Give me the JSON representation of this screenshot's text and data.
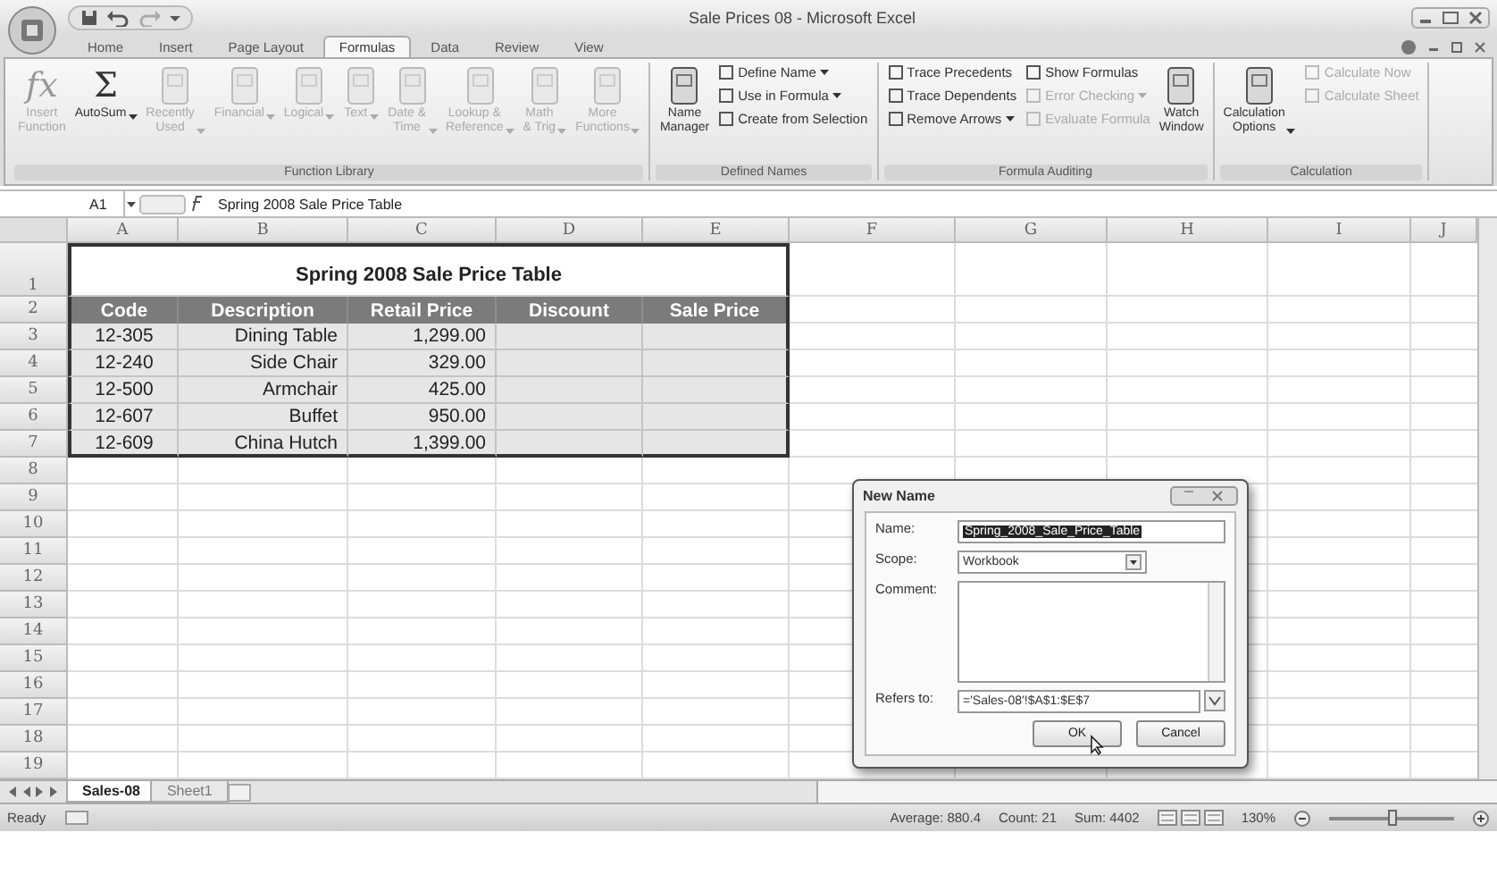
{
  "title_bar": {
    "title": "Sale Prices 08 - Microsoft Excel"
  },
  "ribbon": {
    "tabs": [
      {
        "label": "Home",
        "selected": false
      },
      {
        "label": "Insert",
        "selected": false
      },
      {
        "label": "Page Layout",
        "selected": false
      },
      {
        "label": "Formulas",
        "selected": true
      },
      {
        "label": "Data",
        "selected": false
      },
      {
        "label": "Review",
        "selected": false
      },
      {
        "label": "View",
        "selected": false
      }
    ],
    "groups": [
      {
        "label": "Function Library",
        "items": [
          {
            "kind": "large",
            "glyph": "fx",
            "label": "Insert\nFunction",
            "disabled": true,
            "dropdown": false
          },
          {
            "kind": "large",
            "glyph": "Σ",
            "label": "AutoSum",
            "disabled": false,
            "dropdown": true
          },
          {
            "kind": "large",
            "label": "Recently\nUsed",
            "disabled": true,
            "dropdown": true
          },
          {
            "kind": "large",
            "label": "Financial",
            "disabled": true,
            "dropdown": true
          },
          {
            "kind": "large",
            "label": "Logical",
            "disabled": true,
            "dropdown": true
          },
          {
            "kind": "large",
            "label": "Text",
            "disabled": true,
            "dropdown": true
          },
          {
            "kind": "large",
            "label": "Date &\nTime",
            "disabled": true,
            "dropdown": true
          },
          {
            "kind": "large",
            "label": "Lookup &\nReference",
            "disabled": true,
            "dropdown": true
          },
          {
            "kind": "large",
            "label": "Math\n& Trig",
            "disabled": true,
            "dropdown": true
          },
          {
            "kind": "large",
            "label": "More\nFunctions",
            "disabled": true,
            "dropdown": true
          }
        ]
      },
      {
        "label": "Defined Names",
        "items": [
          {
            "kind": "large",
            "label": "Name\nManager",
            "disabled": false,
            "dropdown": false
          },
          {
            "kind": "small",
            "label": "Define Name",
            "disabled": false,
            "dropdown": true
          },
          {
            "kind": "small",
            "label": "Use in Formula",
            "disabled": false,
            "dropdown": true
          },
          {
            "kind": "small",
            "label": "Create from Selection",
            "disabled": false,
            "dropdown": false
          }
        ]
      },
      {
        "label": "Formula Auditing",
        "items": [
          {
            "kind": "small",
            "label": "Trace Precedents",
            "disabled": false,
            "dropdown": false
          },
          {
            "kind": "small",
            "label": "Trace Dependents",
            "disabled": false,
            "dropdown": false
          },
          {
            "kind": "small",
            "label": "Remove Arrows",
            "disabled": false,
            "dropdown": true
          },
          {
            "kind": "small",
            "label": "Show Formulas",
            "disabled": false,
            "dropdown": false
          },
          {
            "kind": "small",
            "label": "Error Checking",
            "disabled": true,
            "dropdown": true
          },
          {
            "kind": "small",
            "label": "Evaluate Formula",
            "disabled": true,
            "dropdown": false
          },
          {
            "kind": "large",
            "label": "Watch\nWindow",
            "disabled": false,
            "dropdown": false
          }
        ]
      },
      {
        "label": "Calculation",
        "items": [
          {
            "kind": "large",
            "label": "Calculation\nOptions",
            "disabled": false,
            "dropdown": true
          },
          {
            "kind": "small",
            "label": "Calculate Now",
            "disabled": true,
            "dropdown": false
          },
          {
            "kind": "small",
            "label": "Calculate Sheet",
            "disabled": true,
            "dropdown": false
          }
        ]
      }
    ]
  },
  "formula_bar": {
    "name_box": "A1",
    "formula": "Spring 2008 Sale Price Table"
  },
  "sheet": {
    "columns": [
      "A",
      "B",
      "C",
      "D",
      "E",
      "F",
      "G",
      "H",
      "I",
      "J"
    ],
    "rows": [
      "1",
      "2",
      "3",
      "4",
      "5",
      "6",
      "7",
      "8",
      "9",
      "10",
      "11",
      "12",
      "13",
      "14",
      "15",
      "16",
      "17",
      "18",
      "19"
    ],
    "table": {
      "title": "Spring 2008 Sale Price Table",
      "headers": [
        "Code",
        "Description",
        "Retail Price",
        "Discount",
        "Sale Price"
      ],
      "rows": [
        [
          "12-305",
          "Dining Table",
          "1,299.00"
        ],
        [
          "12-240",
          "Side Chair",
          "329.00"
        ],
        [
          "12-500",
          "Armchair",
          "425.00"
        ],
        [
          "12-607",
          "Buffet",
          "950.00"
        ],
        [
          "12-609",
          "China Hutch",
          "1,399.00"
        ]
      ]
    }
  },
  "dialog": {
    "title": "New Name",
    "name_label": "Name:",
    "name_value": "Spring_2008_Sale_Price_Table",
    "name_value_selected": true,
    "scope_label": "Scope:",
    "scope_value": "Workbook",
    "comment_label": "Comment:",
    "refers_label": "Refers to:",
    "refers_value": "='Sales-08'!$A$1:$E$7",
    "buttons": [
      "OK",
      "Cancel"
    ]
  },
  "sheet_tabs": [
    {
      "label": "Sales-08",
      "selected": true
    },
    {
      "label": "Sheet1",
      "selected": false
    }
  ],
  "status_bar": {
    "mode": "Ready",
    "average": "Average: 880.4",
    "count": "Count: 21",
    "sum": "Sum: 4402",
    "zoom": "130%",
    "zoom_slider": {
      "level": 0.5
    }
  }
}
